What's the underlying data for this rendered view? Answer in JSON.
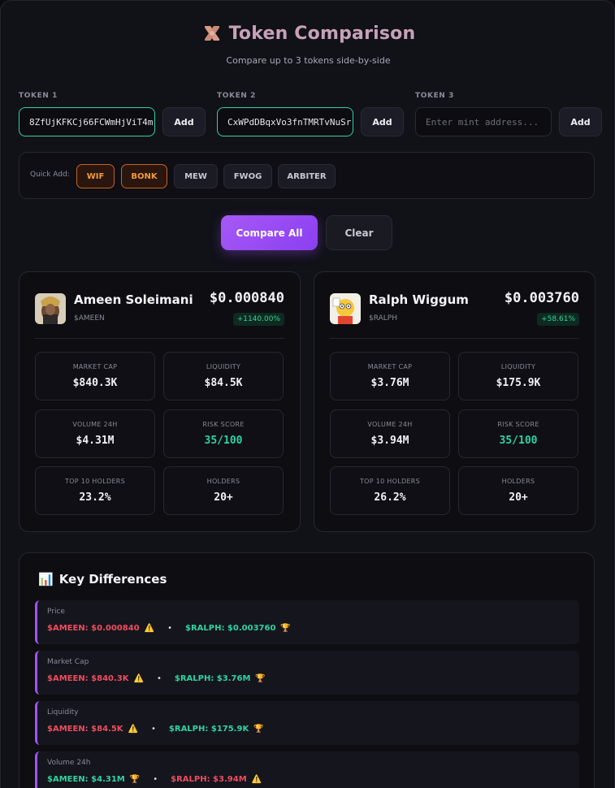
{
  "header": {
    "title": "Token Comparison",
    "subtitle": "Compare up to 3 tokens side-by-side"
  },
  "inputs": [
    {
      "label": "TOKEN 1",
      "value": "8ZfUjKFKCj66FCWmHjViT4m",
      "placeholder": "Enter mint address...",
      "add_label": "Add"
    },
    {
      "label": "TOKEN 2",
      "value": "CxWPdDBqxVo3fnTMRTvNuSr",
      "placeholder": "Enter mint address...",
      "add_label": "Add"
    },
    {
      "label": "TOKEN 3",
      "value": "",
      "placeholder": "Enter mint address...",
      "add_label": "Add"
    }
  ],
  "quick_add": {
    "label": "Quick Add:",
    "chips": [
      "WIF",
      "BONK",
      "MEW",
      "FWOG",
      "ARBITER"
    ]
  },
  "actions": {
    "compare": "Compare All",
    "clear": "Clear"
  },
  "tokens": [
    {
      "name": "Ameen Soleimani",
      "symbol": "$AMEEN",
      "price": "$0.000840",
      "change": "+1140.00%",
      "stats": [
        {
          "label": "MARKET CAP",
          "value": "$840.3K"
        },
        {
          "label": "LIQUIDITY",
          "value": "$84.5K"
        },
        {
          "label": "VOLUME 24H",
          "value": "$4.31M"
        },
        {
          "label": "RISK SCORE",
          "value": "35/100"
        },
        {
          "label": "TOP 10 HOLDERS",
          "value": "23.2%"
        },
        {
          "label": "HOLDERS",
          "value": "20+"
        }
      ]
    },
    {
      "name": "Ralph Wiggum",
      "symbol": "$RALPH",
      "price": "$0.003760",
      "change": "+58.61%",
      "stats": [
        {
          "label": "MARKET CAP",
          "value": "$3.76M"
        },
        {
          "label": "LIQUIDITY",
          "value": "$175.9K"
        },
        {
          "label": "VOLUME 24H",
          "value": "$3.94M"
        },
        {
          "label": "RISK SCORE",
          "value": "35/100"
        },
        {
          "label": "TOP 10 HOLDERS",
          "value": "26.2%"
        },
        {
          "label": "HOLDERS",
          "value": "20+"
        }
      ]
    }
  ],
  "differences": {
    "title": "Key Differences",
    "title_icon": "📊",
    "rows": [
      {
        "label": "Price",
        "a": "$AMEEN: $0.000840",
        "a_icon": "⚠️",
        "b": "$RALPH: $0.003760",
        "b_icon": "🏆"
      },
      {
        "label": "Market Cap",
        "a": "$AMEEN: $840.3K",
        "a_icon": "⚠️",
        "b": "$RALPH: $3.76M",
        "b_icon": "🏆"
      },
      {
        "label": "Liquidity",
        "a": "$AMEEN: $84.5K",
        "a_icon": "⚠️",
        "b": "$RALPH: $175.9K",
        "b_icon": "🏆"
      },
      {
        "label": "Volume 24h",
        "a": "$AMEEN: $4.31M",
        "a_icon": "🏆",
        "b": "$RALPH: $3.94M",
        "b_icon": "⚠️"
      }
    ]
  },
  "colors": {
    "accent": "#9f55f3",
    "good": "#2fd3a0",
    "bad": "#ef4d5e",
    "warning_chip": "#f09a3e"
  }
}
